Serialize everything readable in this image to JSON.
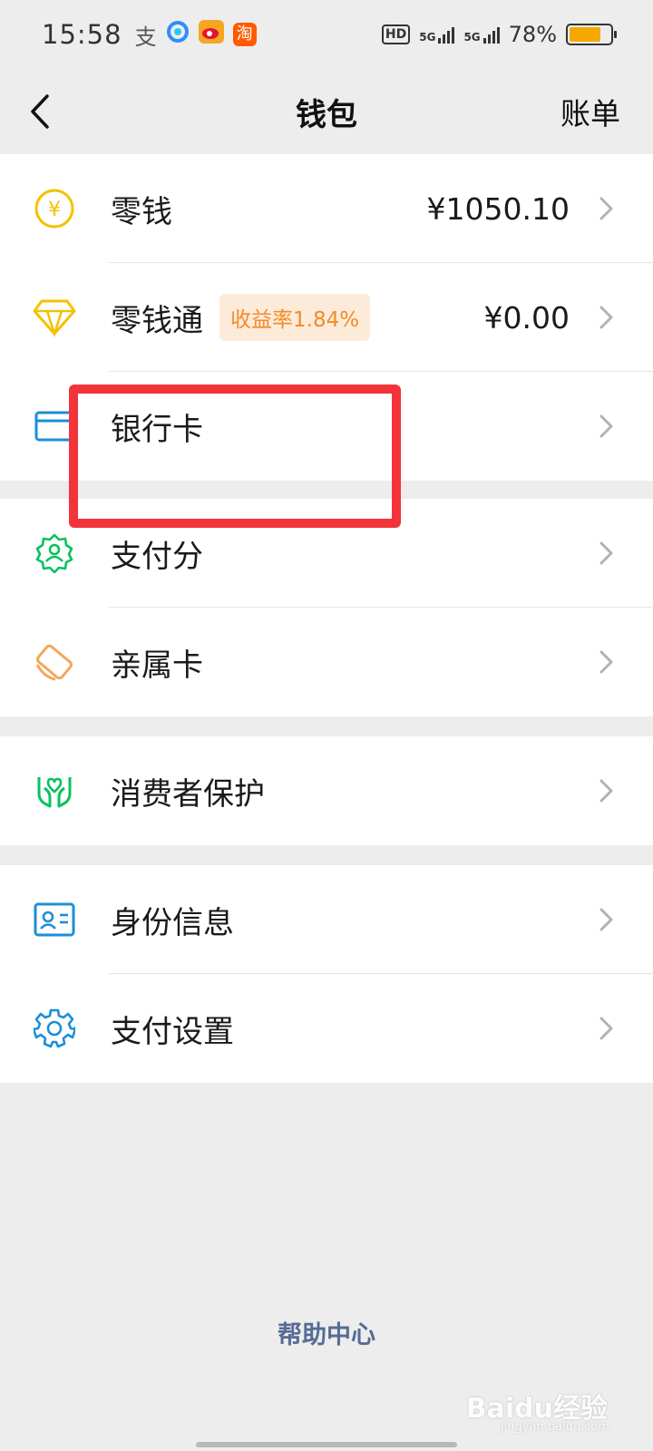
{
  "status_bar": {
    "time": "15:58",
    "apps": [
      {
        "icon": "alipay-icon",
        "glyph": "支",
        "color": "#555555"
      },
      {
        "icon": "browser-icon",
        "glyph": "",
        "color": "#2f8cff"
      },
      {
        "icon": "weibo-icon",
        "glyph": "",
        "color": "#f5a623"
      },
      {
        "icon": "taobao-icon",
        "glyph": "淘",
        "color": "#ff5a00"
      }
    ],
    "hd": "HD",
    "network1": "5G",
    "network2": "5G",
    "battery_percent": "78%",
    "battery_level": 0.78
  },
  "nav": {
    "back_icon": "back-arrow-icon",
    "title": "钱包",
    "action": "账单"
  },
  "groups": [
    {
      "items": [
        {
          "name": "change",
          "icon": "yuan-coin-icon",
          "label": "零钱",
          "value": "¥1050.10"
        },
        {
          "name": "change-plus",
          "icon": "diamond-icon",
          "label": "零钱通",
          "badge": "收益率1.84%",
          "value": "¥0.00"
        },
        {
          "name": "bank-card",
          "icon": "bank-card-icon",
          "label": "银行卡",
          "value": ""
        }
      ]
    },
    {
      "items": [
        {
          "name": "pay-score",
          "icon": "pay-score-icon",
          "label": "支付分"
        },
        {
          "name": "family-card",
          "icon": "family-card-icon",
          "label": "亲属卡"
        }
      ]
    },
    {
      "items": [
        {
          "name": "consumer-protection",
          "icon": "protection-hands-icon",
          "label": "消费者保护"
        }
      ]
    },
    {
      "items": [
        {
          "name": "identity-info",
          "icon": "id-card-icon",
          "label": "身份信息"
        },
        {
          "name": "payment-settings",
          "icon": "gear-icon",
          "label": "支付设置"
        }
      ]
    }
  ],
  "help": "帮助中心",
  "watermark": {
    "main": "Baidu经验",
    "sub": "jingyan.baidu.com"
  },
  "colors": {
    "background": "#ededed",
    "link": "#576b95",
    "badge_text": "#f08c2a",
    "badge_bg": "#fdebd9",
    "highlight": "#f2333a",
    "yellow_icon": "#f2c200",
    "green_icon": "#07c160",
    "orange_icon": "#f5a65b",
    "blue_icon": "#1b8fd9"
  }
}
